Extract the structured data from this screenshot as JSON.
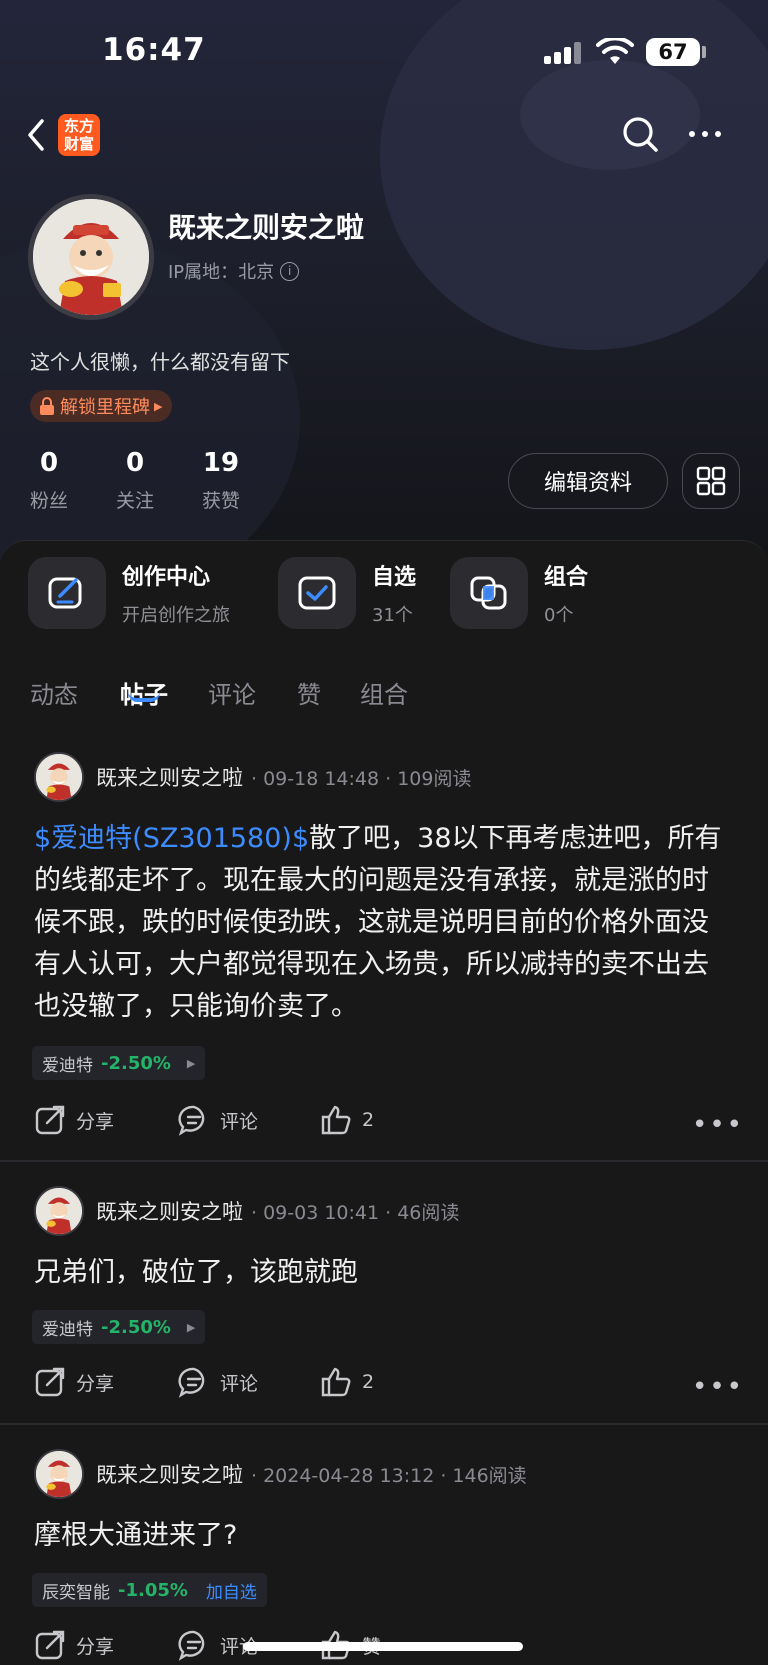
{
  "status_bar": {
    "time": "16:47",
    "battery": "67"
  },
  "app": {
    "logo_line1": "东方",
    "logo_line2": "财富"
  },
  "profile": {
    "username": "既来之则安之啦",
    "ip_location": "IP属地：北京",
    "bio": "这个人很懒，什么都没有留下",
    "milestone_label": "解锁里程碑",
    "stats": [
      {
        "value": "0",
        "label": "粉丝"
      },
      {
        "value": "0",
        "label": "关注"
      },
      {
        "value": "19",
        "label": "获赞"
      }
    ],
    "edit_label": "编辑资料"
  },
  "shortcuts": [
    {
      "title": "创作中心",
      "subtitle": "开启创作之旅",
      "icon": "edit-icon"
    },
    {
      "title": "自选",
      "subtitle": "31个",
      "icon": "check-square-icon"
    },
    {
      "title": "组合",
      "subtitle": "0个",
      "icon": "overlap-squares-icon"
    }
  ],
  "tabs": [
    "动态",
    "帖子",
    "评论",
    "赞",
    "组合"
  ],
  "active_tab": "帖子",
  "colors": {
    "accent": "#3d8cff",
    "down": "#25b36a",
    "brand": "#ff5a1f"
  },
  "posts": [
    {
      "author": "既来之则安之啦",
      "meta": "· 09-18 14:48 · 109阅读",
      "stock_link": "$爱迪特(SZ301580)$",
      "body": "散了吧，38以下再考虑进吧，所有的线都走坏了。现在最大的问题是没有承接，就是涨的时候不跟，跌的时候使劲跌，这就是说明目前的价格外面没有人认可，大户都觉得现在入场贵，所以减持的卖不出去也没辙了，只能询价卖了。",
      "tag_name": "爱迪特",
      "tag_change": "-2.50%",
      "share": "分享",
      "comment": "评论",
      "likes": "2"
    },
    {
      "author": "既来之则安之啦",
      "meta": "· 09-03 10:41 · 46阅读",
      "body": "兄弟们，破位了，该跑就跑",
      "tag_name": "爱迪特",
      "tag_change": "-2.50%",
      "share": "分享",
      "comment": "评论",
      "likes": "2"
    },
    {
      "author": "既来之则安之啦",
      "meta": "· 2024-04-28 13:12 · 146阅读",
      "body": "摩根大通进来了?",
      "tag_name": "辰奕智能",
      "tag_change": "-1.05%",
      "tag_action": "加自选",
      "share": "分享",
      "comment": "评论",
      "likes": "赞"
    }
  ]
}
